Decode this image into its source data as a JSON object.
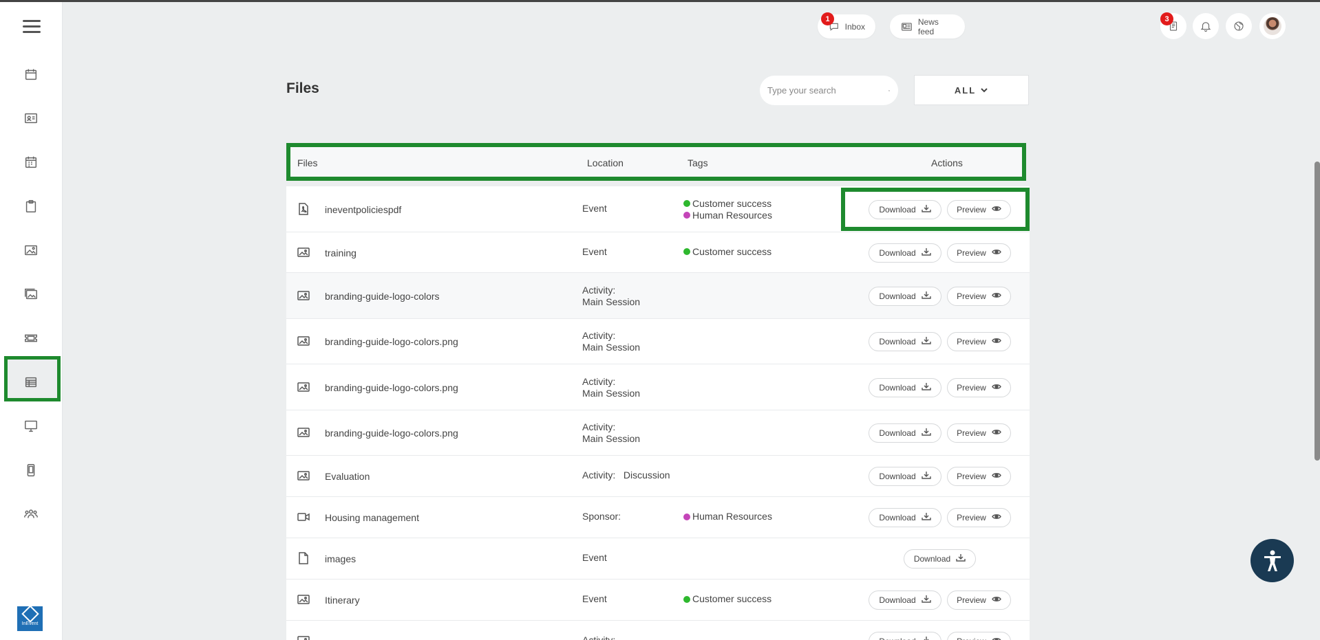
{
  "topbar": {
    "inbox_label": "Inbox",
    "inbox_badge": "1",
    "newsfeed_label": "News feed",
    "notes_badge": "3"
  },
  "page": {
    "title": "Files",
    "search_placeholder": "Type your search",
    "filter_label": "ALL"
  },
  "table": {
    "headers": {
      "files": "Files",
      "location": "Location",
      "tags": "Tags",
      "actions": "Actions"
    },
    "download_label": "Download",
    "preview_label": "Preview",
    "rows": [
      {
        "name": "ineventpoliciespdf",
        "icon": "pdf-icon",
        "location_line1": "Event",
        "location_line2": "",
        "tags": [
          "Customer success",
          "Human Resources"
        ]
      },
      {
        "name": "training",
        "icon": "image-icon",
        "location_line1": "Event",
        "location_line2": "",
        "tags": [
          "Customer success"
        ]
      },
      {
        "name": "branding-guide-logo-colors",
        "icon": "image-icon",
        "location_line1": "Activity:",
        "location_line2": "Main Session",
        "tags": []
      },
      {
        "name": "branding-guide-logo-colors.png",
        "icon": "image-icon",
        "location_line1": "Activity:",
        "location_line2": "Main Session",
        "tags": []
      },
      {
        "name": "branding-guide-logo-colors.png",
        "icon": "image-icon",
        "location_line1": "Activity:",
        "location_line2": "Main Session",
        "tags": []
      },
      {
        "name": "branding-guide-logo-colors.png",
        "icon": "image-icon",
        "location_line1": "Activity:",
        "location_line2": "Main Session",
        "tags": []
      },
      {
        "name": "Evaluation",
        "icon": "image-icon",
        "location_line1": "Activity:   Discussion",
        "location_line2": "",
        "tags": []
      },
      {
        "name": "Housing management",
        "icon": "video-icon",
        "location_line1": "Sponsor:",
        "location_line2": "",
        "tags": [
          "Human Resources"
        ]
      },
      {
        "name": "images",
        "icon": "document-icon",
        "location_line1": "Event",
        "location_line2": "",
        "tags": []
      },
      {
        "name": "Itinerary",
        "icon": "image-icon",
        "location_line1": "Event",
        "location_line2": "",
        "tags": [
          "Customer success"
        ]
      },
      {
        "name": "",
        "icon": "image-icon",
        "location_line1": "Activity:",
        "location_line2": "",
        "tags": []
      }
    ]
  },
  "tag_colors": {
    "Customer success": "#2eb82e",
    "Human Resources": "#c445b8"
  },
  "colors": {
    "highlight": "#1e8a2e",
    "badge": "#e21b1b",
    "accessibility_button": "#1a3a53",
    "brand_logo": "#1f6fb5"
  },
  "logo_text": "InEvent"
}
